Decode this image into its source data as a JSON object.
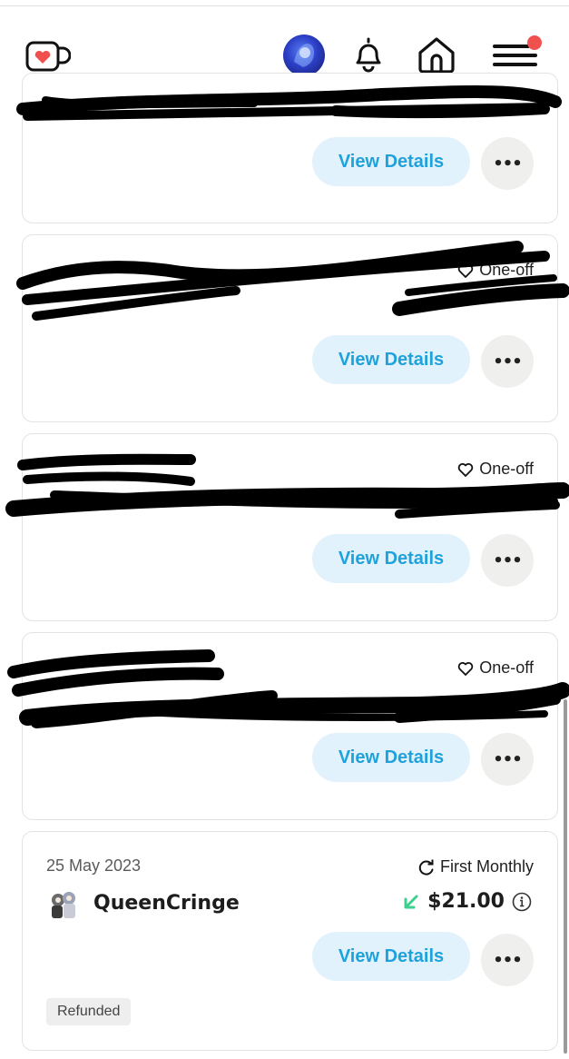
{
  "header": {
    "logo_icon": "ko-fi-cup-heart-icon",
    "avatar_icon": "user-avatar",
    "notifications_icon": "bell-icon",
    "home_icon": "home-icon",
    "menu_icon": "hamburger-menu-icon",
    "menu_badge_color": "#f0514f"
  },
  "transactions": [
    {
      "type_label": "",
      "view_label": "View Details",
      "more_label": "•••"
    },
    {
      "type_label": "One-off",
      "view_label": "View Details",
      "more_label": "•••"
    },
    {
      "type_label": "One-off",
      "view_label": "View Details",
      "more_label": "•••"
    },
    {
      "type_label": "One-off",
      "view_label": "View Details",
      "more_label": "•••"
    }
  ],
  "last_transaction": {
    "date": "25 May 2023",
    "type_label": "First Monthly",
    "type_icon": "recurring-icon",
    "supporter_name": "QueenCringe",
    "amount_direction_icon": "arrow-down-left-icon",
    "amount": "$21.00",
    "info_icon": "info-icon",
    "view_label": "View Details",
    "more_label": "•••",
    "status_badge": "Refunded"
  },
  "colors": {
    "accent": "#1ea2dc",
    "button_bg": "#e2f2fc",
    "incoming_arrow": "#3ecf8e"
  }
}
